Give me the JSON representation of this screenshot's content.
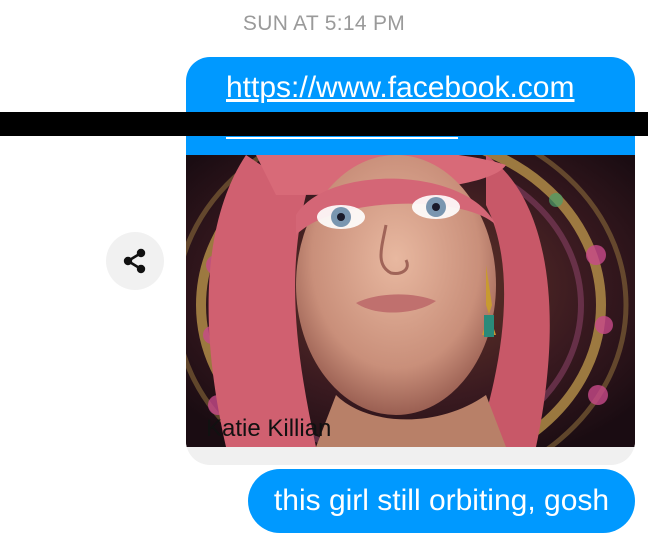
{
  "thread": {
    "timestamp": "SUN AT 5:14 PM"
  },
  "link_preview": {
    "url": "https://www.facebook.com",
    "title": "Katie Killian"
  },
  "share": {
    "icon": "share-icon"
  },
  "message": {
    "text": "this girl still orbiting, gosh"
  },
  "colors": {
    "bubble_blue": "#0099ff",
    "card_gray": "#f0f0f0",
    "timestamp_gray": "#9a9a9a"
  }
}
